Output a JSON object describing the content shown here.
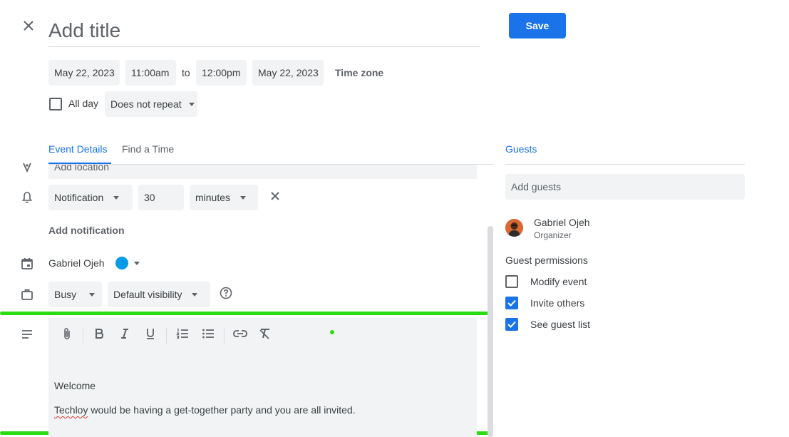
{
  "header": {
    "title_placeholder": "Add title",
    "save_label": "Save"
  },
  "datetime": {
    "start_date": "May 22, 2023",
    "start_time": "11:00am",
    "to_label": "to",
    "end_time": "12:00pm",
    "end_date": "May 22, 2023",
    "timezone_label": "Time zone",
    "all_day_label": "All day",
    "all_day_checked": false,
    "repeat_value": "Does not repeat"
  },
  "tabs": [
    {
      "label": "Event Details",
      "active": true
    },
    {
      "label": "Find a Time",
      "active": false
    }
  ],
  "details": {
    "location_placeholder": "Add location",
    "notification_type": "Notification",
    "notification_amount": "30",
    "notification_unit": "minutes",
    "add_notification_label": "Add notification",
    "calendar_owner": "Gabriel Ojeh",
    "calendar_color": "#039be5",
    "availability": "Busy",
    "visibility": "Default visibility"
  },
  "description": {
    "line1": "Welcome",
    "line2_misspelled": "Techloy",
    "line2_rest": " would be having a get-together party and you are all invited."
  },
  "guests": {
    "tab_label": "Guests",
    "add_placeholder": "Add guests",
    "organizer_name": "Gabriel Ojeh",
    "organizer_role": "Organizer",
    "permissions_title": "Guest permissions",
    "permissions": [
      {
        "label": "Modify event",
        "checked": false
      },
      {
        "label": "Invite others",
        "checked": true
      },
      {
        "label": "See guest list",
        "checked": true
      }
    ]
  },
  "colors": {
    "accent": "#1a73e8",
    "highlight": "#2bdc14"
  }
}
